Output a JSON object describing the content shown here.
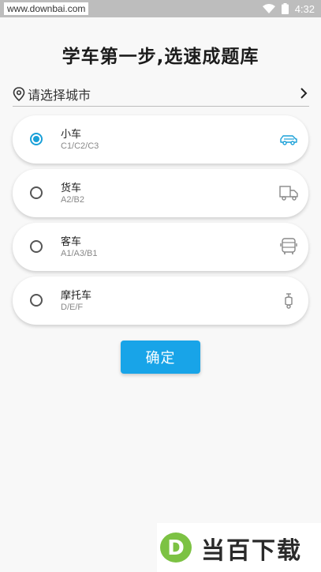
{
  "status_bar": {
    "watermark_url": "www.downbai.com",
    "time": "4:32",
    "icons": [
      "wifi-icon",
      "battery-icon"
    ]
  },
  "title": "学车第一步,选速成题库",
  "city_selector": {
    "label": "请选择城市",
    "icon": "location-pin-icon",
    "chevron": "chevron-right-icon"
  },
  "options": [
    {
      "name": "小车",
      "license": "C1/C2/C3",
      "icon": "car-icon",
      "selected": true
    },
    {
      "name": "货车",
      "license": "A2/B2",
      "icon": "truck-icon",
      "selected": false
    },
    {
      "name": "客车",
      "license": "A1/A3/B1",
      "icon": "bus-icon",
      "selected": false
    },
    {
      "name": "摩托车",
      "license": "D/E/F",
      "icon": "scooter-icon",
      "selected": false
    }
  ],
  "confirm_label": "确定",
  "brand_watermark": {
    "text": "当百下载",
    "letter": "D"
  },
  "colors": {
    "accent": "#18a4e8",
    "selected_radio": "#1aa0d8",
    "background": "#f8f8f8",
    "status_bar": "#bdbdbd"
  }
}
